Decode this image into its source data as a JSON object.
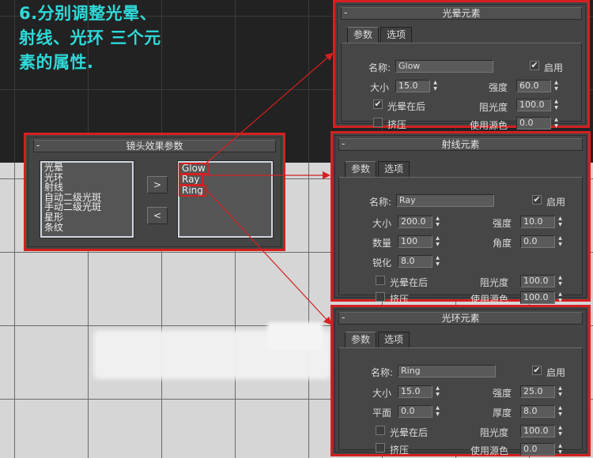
{
  "heading": {
    "lines": [
      "6.分别调整光晕、",
      "射线、光环 三个元",
      "素的属性."
    ]
  },
  "lens_panel": {
    "title": "镜头效果参数",
    "available": [
      "光晕",
      "光环",
      "射线",
      "自动二级光斑",
      "手动二级光斑",
      "星形",
      "条纹"
    ],
    "applied": [
      "Glow",
      "Ray",
      "Ring"
    ],
    "add_label": ">",
    "remove_label": "<"
  },
  "glow_panel": {
    "title": "光晕元素",
    "tabs": [
      "参数",
      "选项"
    ],
    "name_label": "名称:",
    "name_value": "Glow",
    "enable_label": "启用",
    "size_label": "大小",
    "size_value": "15.0",
    "intensity_label": "强度",
    "intensity_value": "60.0",
    "glow_behind_label": "光晕在后",
    "occlusion_label": "阻光度",
    "occlusion_value": "100.0",
    "squeeze_label": "挤压",
    "use_source_color_label": "使用源色",
    "use_source_color_value": "0.0"
  },
  "ray_panel": {
    "title": "射线元素",
    "tabs": [
      "参数",
      "选项"
    ],
    "name_label": "名称:",
    "name_value": "Ray",
    "enable_label": "启用",
    "size_label": "大小",
    "size_value": "200.0",
    "intensity_label": "强度",
    "intensity_value": "10.0",
    "num_label": "数量",
    "num_value": "100",
    "angle_label": "角度",
    "angle_value": "0.0",
    "sharp_label": "锐化",
    "sharp_value": "8.0",
    "glow_behind_label": "光晕在后",
    "occlusion_label": "阻光度",
    "occlusion_value": "100.0",
    "squeeze_label": "挤压",
    "use_source_color_label": "使用源色",
    "use_source_color_value": "100.0"
  },
  "ring_panel": {
    "title": "光环元素",
    "tabs": [
      "参数",
      "选项"
    ],
    "name_label": "名称:",
    "name_value": "Ring",
    "enable_label": "启用",
    "size_label": "大小",
    "size_value": "15.0",
    "intensity_label": "强度",
    "intensity_value": "25.0",
    "plane_label": "平面",
    "plane_value": "0.0",
    "thickness_label": "厚度",
    "thickness_value": "8.0",
    "glow_behind_label": "光晕在后",
    "occlusion_label": "阻光度",
    "occlusion_value": "100.0",
    "squeeze_label": "挤压",
    "use_source_color_label": "使用源色",
    "use_source_color_value": "0.0"
  },
  "colors": {
    "accent_red": "#d42020",
    "heading_cyan": "#2fd9d9",
    "panel_bg": "#444444"
  },
  "icons": {
    "checked": "✔",
    "collapse": "-",
    "spin_up": "▲",
    "spin_down": "▼"
  }
}
